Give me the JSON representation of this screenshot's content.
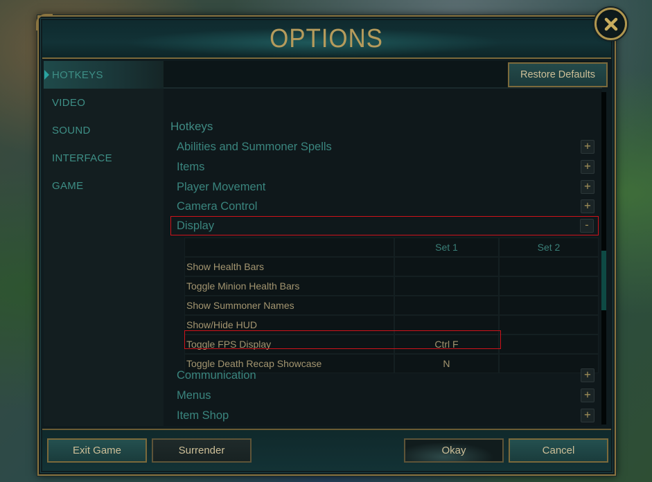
{
  "window": {
    "title": "OPTIONS",
    "close_icon": "close-x-icon"
  },
  "sidebar": {
    "items": [
      {
        "label": "HOTKEYS",
        "active": true
      },
      {
        "label": "VIDEO",
        "active": false
      },
      {
        "label": "SOUND",
        "active": false
      },
      {
        "label": "INTERFACE",
        "active": false
      },
      {
        "label": "GAME",
        "active": false
      }
    ]
  },
  "content": {
    "restore_defaults_label": "Restore Defaults",
    "section_title": "Hotkeys",
    "categories": [
      {
        "label": "Abilities and Summoner Spells",
        "state": "+"
      },
      {
        "label": "Items",
        "state": "+"
      },
      {
        "label": "Player Movement",
        "state": "+"
      },
      {
        "label": "Camera Control",
        "state": "+"
      },
      {
        "label": "Display",
        "state": "-",
        "expanded": true,
        "highlighted": true
      },
      {
        "label": "Communication",
        "state": "+"
      },
      {
        "label": "Menus",
        "state": "+"
      },
      {
        "label": "Item Shop",
        "state": "+"
      }
    ],
    "key_table": {
      "columns": [
        "",
        "Set 1",
        "Set 2"
      ],
      "rows": [
        {
          "action": "Show Health Bars",
          "set1": "",
          "set2": ""
        },
        {
          "action": "Toggle Minion Health Bars",
          "set1": "",
          "set2": ""
        },
        {
          "action": "Show Summoner Names",
          "set1": "",
          "set2": ""
        },
        {
          "action": "Show/Hide HUD",
          "set1": "",
          "set2": ""
        },
        {
          "action": "Toggle FPS Display",
          "set1": "Ctrl F",
          "set2": "",
          "highlighted": true
        },
        {
          "action": "Toggle Death Recap Showcase",
          "set1": "N",
          "set2": ""
        }
      ]
    },
    "scroll_position": 0.58
  },
  "footer": {
    "exit_game_label": "Exit Game",
    "surrender_label": "Surrender",
    "okay_label": "Okay",
    "cancel_label": "Cancel"
  },
  "colors": {
    "accent_gold": "#b59b5c",
    "teal_text": "#3e8f86",
    "highlight_red": "#d0121a"
  }
}
